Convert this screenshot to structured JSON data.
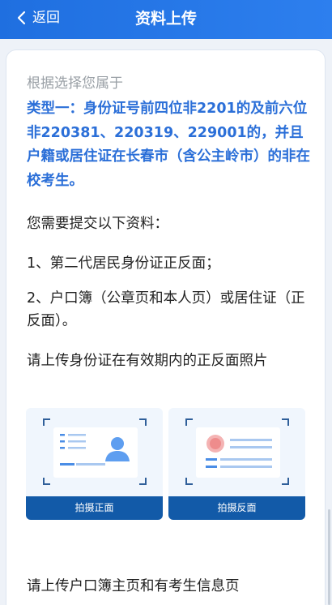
{
  "header": {
    "back_label": "返回",
    "title": "资料上传"
  },
  "content": {
    "hint": "根据选择您属于",
    "type_description": "类型一：身份证号前四位非2201的及前六位非220381、220319、229001的，并且户籍或居住证在长春市（含公主岭市）的非在校考生。",
    "intro": "您需要提交以下资料：",
    "item1": "1、第二代居民身份证正反面；",
    "item2": "2、户口簿（公章页和本人页）或居住证（正反面）。",
    "id_instruction": "请上传身份证在有效期内的正反面照片",
    "front_button": "拍摄正面",
    "back_button": "拍摄反面",
    "hukou_instruction": "请上传户口簿主页和有考生信息页"
  },
  "colors": {
    "header": "#2270e6",
    "accent_text": "#2b6fd8",
    "upload_button": "#125aa8",
    "upload_bg": "#f0f6fd"
  }
}
